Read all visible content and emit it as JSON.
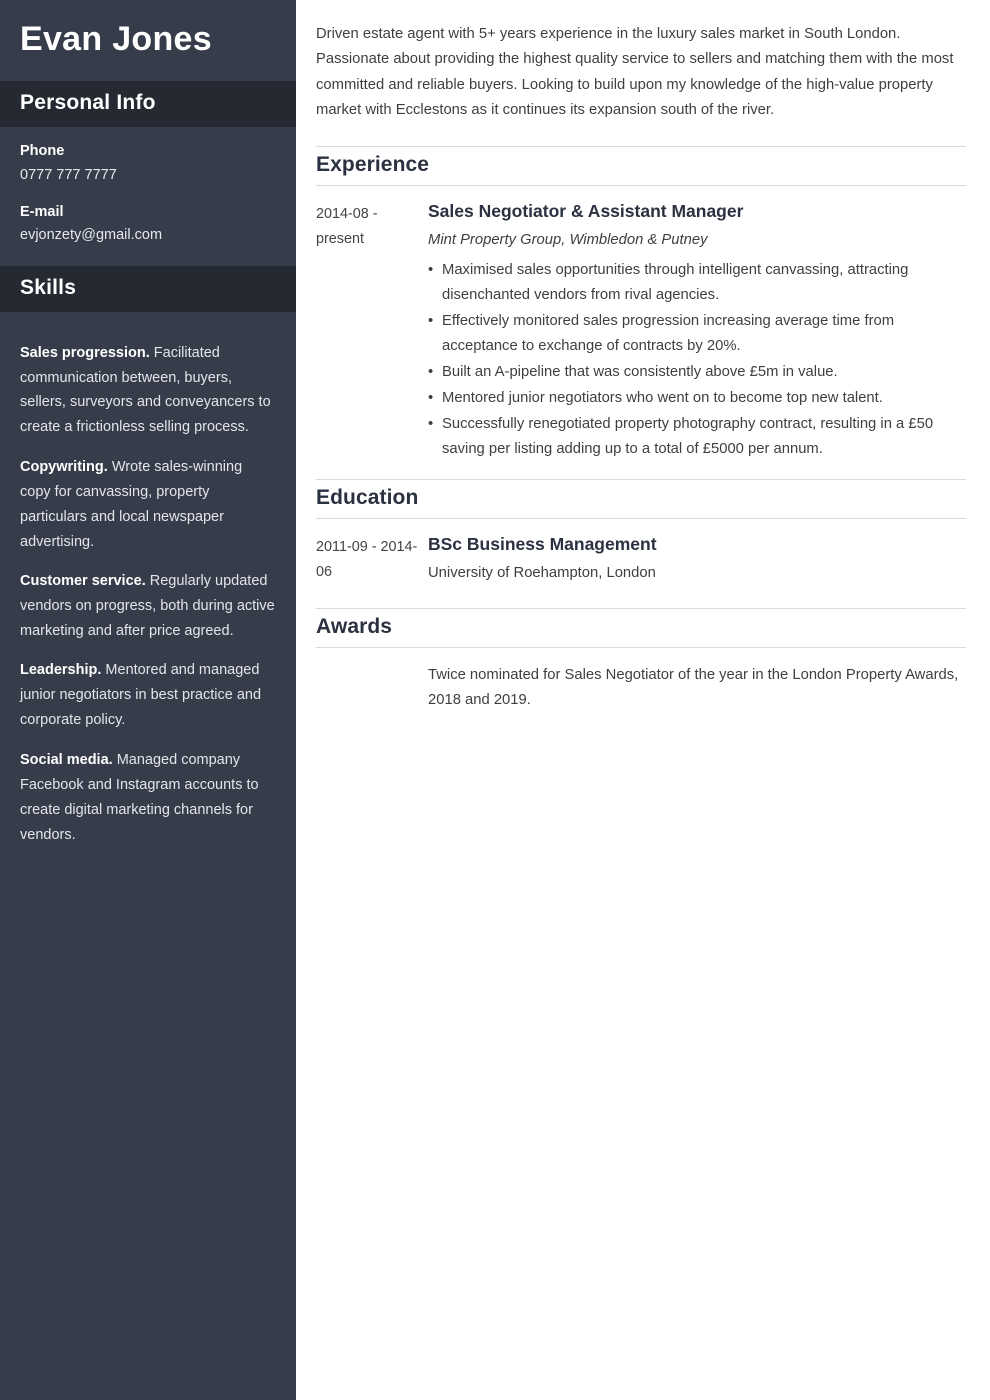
{
  "theme": {
    "sidebar_bg": "#363c49",
    "sidebar_head_bg": "#252932",
    "main_bg": "#ffffff",
    "heading_color": "#2b3140",
    "body_text_color": "#3f3f3f",
    "rule_color": "#dadada"
  },
  "sidebar": {
    "name": "Evan Jones",
    "personal_info": {
      "heading": "Personal Info",
      "fields": [
        {
          "label": "Phone",
          "value": "0777 777 7777"
        },
        {
          "label": "E-mail",
          "value": "evjonzety@gmail.com"
        }
      ]
    },
    "skills": {
      "heading": "Skills",
      "items": [
        {
          "name": "Sales progression.",
          "description": "Facilitated communication between, buyers, sellers, surveyors and conveyancers to create a frictionless selling process."
        },
        {
          "name": "Copywriting.",
          "description": "Wrote sales-winning copy for canvassing, property particulars and local newspaper advertising."
        },
        {
          "name": "Customer service.",
          "description": "Regularly updated vendors on progress, both during active marketing and after price agreed."
        },
        {
          "name": "Leadership.",
          "description": "Mentored and managed junior negotiators in best practice and corporate policy."
        },
        {
          "name": "Social media.",
          "description": "Managed company Facebook and Instagram accounts to create digital marketing channels for vendors."
        }
      ]
    }
  },
  "main": {
    "summary": "Driven estate agent with 5+ years experience in the luxury sales market in South London. Passionate about providing the highest quality service to sellers and matching them with the most committed and reliable buyers. Looking to build upon my knowledge of the high-value property market with Ecclestons as it continues its expansion south of the river.",
    "experience": {
      "heading": "Experience",
      "entries": [
        {
          "dates": "2014-08 - present",
          "title": "Sales Negotiator & Assistant Manager",
          "subtitle": "Mint Property Group, Wimbledon & Putney",
          "bullets": [
            "Maximised sales opportunities through intelligent canvassing, attracting disenchanted vendors from rival agencies.",
            "Effectively monitored sales progression increasing average time from acceptance to exchange of contracts by 20%.",
            "Built an A-pipeline that was consistently above £5m in value.",
            "Mentored junior negotiators who went on to become top new talent.",
            "Successfully renegotiated property photography contract, resulting in a £50 saving per listing adding up to a total of £5000 per annum."
          ]
        }
      ]
    },
    "education": {
      "heading": "Education",
      "entries": [
        {
          "dates": "2011-09 - 2014-06",
          "title": "BSc Business Management",
          "subtitle": "University of Roehampton, London"
        }
      ]
    },
    "awards": {
      "heading": "Awards",
      "text": "Twice nominated for Sales Negotiator of the year in the London Property Awards, 2018 and 2019."
    }
  }
}
